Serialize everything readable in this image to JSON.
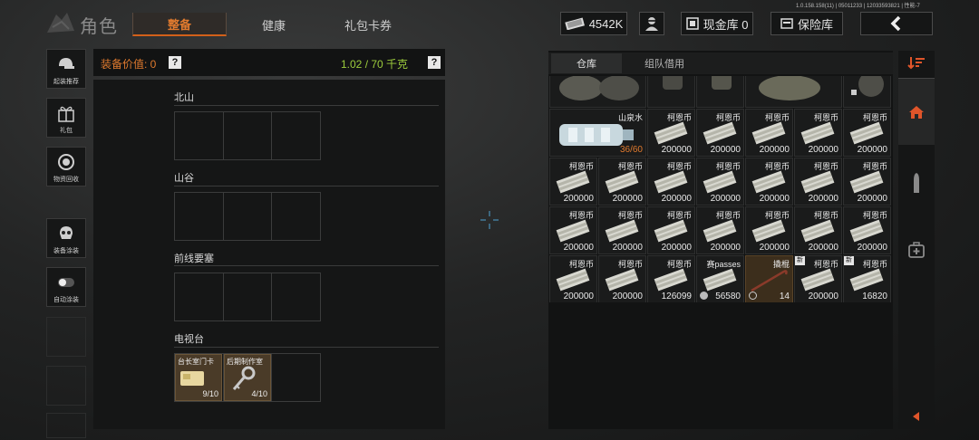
{
  "version": "1.0.158.158(11) | 05011233 | 12033593821 | 性能-7",
  "app": {
    "title": "角色"
  },
  "tabs": [
    {
      "label": "整备",
      "active": true
    },
    {
      "label": "健康",
      "active": false
    },
    {
      "label": "礼包卡券",
      "active": false
    }
  ],
  "topbar": {
    "currency": "4542K",
    "cash_vault": "现金库 0",
    "insurance": "保险库"
  },
  "sidebar": {
    "items": [
      {
        "label": "起装推荐",
        "icon": "helmet-gun-icon"
      },
      {
        "label": "礼包",
        "icon": "gift-icon"
      },
      {
        "label": "物资回收",
        "icon": "recycle-icon"
      },
      {
        "label": "装备涂装",
        "icon": "paint-mask-icon"
      },
      {
        "label": "自动涂装",
        "icon": "toggle-icon"
      }
    ]
  },
  "loadout": {
    "equip_value_label": "装备价值: 0",
    "weight": "1.02 / 70 千克",
    "help": "?",
    "maps": [
      {
        "title": "北山"
      },
      {
        "title": "山谷"
      },
      {
        "title": "前线要塞"
      },
      {
        "title": "电视台"
      }
    ],
    "keys": [
      {
        "name": "台长室门卡",
        "count": "9/10"
      },
      {
        "name": "后期制作室",
        "count": "4/10"
      }
    ]
  },
  "stash": {
    "tabs": [
      {
        "label": "仓库",
        "active": true
      },
      {
        "label": "组队借用",
        "active": false
      }
    ],
    "water": {
      "name": "山泉水",
      "count": "36/60"
    },
    "rows": [
      [
        {
          "name": "柯恩币",
          "value": "200000"
        },
        {
          "name": "柯恩币",
          "value": "200000"
        },
        {
          "name": "柯恩币",
          "value": "200000"
        },
        {
          "name": "柯恩币",
          "value": "200000"
        },
        {
          "name": "柯恩币",
          "value": "200000"
        }
      ],
      [
        {
          "name": "柯恩币",
          "value": "200000"
        },
        {
          "name": "柯恩币",
          "value": "200000"
        },
        {
          "name": "柯恩币",
          "value": "200000"
        },
        {
          "name": "柯恩币",
          "value": "200000"
        },
        {
          "name": "柯恩币",
          "value": "200000"
        },
        {
          "name": "柯恩币",
          "value": "200000"
        },
        {
          "name": "柯恩币",
          "value": "200000"
        }
      ],
      [
        {
          "name": "柯恩币",
          "value": "200000"
        },
        {
          "name": "柯恩币",
          "value": "200000"
        },
        {
          "name": "柯恩币",
          "value": "200000"
        },
        {
          "name": "柯恩币",
          "value": "200000"
        },
        {
          "name": "柯恩币",
          "value": "200000"
        },
        {
          "name": "柯恩币",
          "value": "200000"
        },
        {
          "name": "柯恩币",
          "value": "200000"
        }
      ],
      [
        {
          "name": "柯恩币",
          "value": "200000"
        },
        {
          "name": "柯恩币",
          "value": "200000"
        },
        {
          "name": "柯恩币",
          "value": "126099"
        },
        {
          "name": "赛passes",
          "value": "56580"
        },
        {
          "name": "撬棍",
          "value": "14"
        },
        {
          "name": "柯恩币",
          "value": "200000",
          "new": "新"
        },
        {
          "name": "柯恩币",
          "value": "16820",
          "new": "新"
        }
      ]
    ]
  },
  "colors": {
    "accent": "#e07a2e",
    "weight_green": "#9ccc3c",
    "bg": "#1e1f1f"
  }
}
